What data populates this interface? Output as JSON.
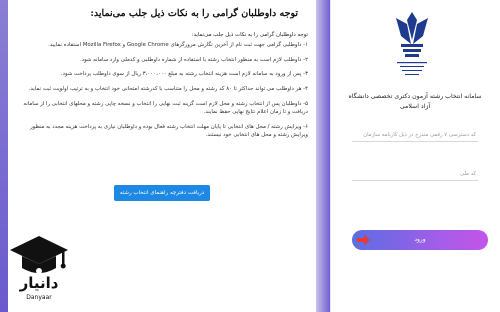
{
  "notice": {
    "title": "توجه داوطلبان گرامی را به نکات ذیل جلب می‌نماید:",
    "intro": "توجه داوطلبان گرامی را به نکات ذیل جلب می‌نماید:",
    "items": [
      "۱- داوطلبی گرامی جهت ثبت نام از آخرین نگارش مرورگرهای Google Chrome و Mozilla Firefox استفاده نمایید.",
      "۲- داوطلب لازم است به منظور انتخاب رشته با استفاده از شماره داوطلبی و کدملی وارد سامانه شود.",
      "۳- پس از ورود به سامانه لازم است هزینه انتخاب رشته به مبلغ ۳،۰۰۰،۰۰۰ ریال از سوی داوطلب پرداخت شود.",
      "۴- هر داوطلب می تواند حداکثر تا ۸۰ کد رشته و محل را متناسب با کدرشته امتحانی خود انتخاب و به ترتیب اولویت ثبت نماید.",
      "۵- داوطلبان پس از انتخاب رشته و محل لازم است گزینه ثبت نهایی را انتخاب و نسخه چاپی رشته و محلهای انتخابی را از سامانه دریافت و تا زمان اعلام نتایج نهایی حفظ نمایند.",
      "۶- ویرایش رشته / محل های انتخابی تا پایان مهلت انتخاب رشته فعال بوده و داوطلبان نیازی به پرداخت هزینه مجدد به منظور ویرایش رشته و محل های انتخابی خود نیستند."
    ],
    "guide_button": "دریافت دفترچه راهنمای انتخاب رشته"
  },
  "login": {
    "system_title": "سامانه انتخاب رشته آزمون دکتری تخصصی دانشگاه آزاد اسلامی",
    "code_placeholder": "کد دسترسی ۷ رقمی مندرج در ذیل کارنامه سازمان",
    "national_id_placeholder": "کد ملی",
    "login_button": "ورود"
  },
  "watermark": {
    "brand_fa": "دانیار",
    "brand_en": "Danyaar"
  },
  "colors": {
    "guide_button": "#1e88e5",
    "login_gradient_start": "#5b6fe0",
    "login_gradient_end": "#c354e8",
    "logo_blue": "#1f3b8f",
    "arrow_red": "#e53935"
  }
}
